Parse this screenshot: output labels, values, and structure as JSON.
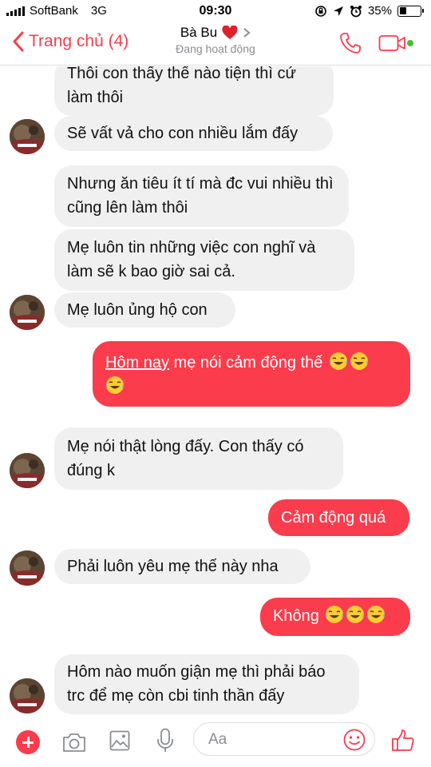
{
  "status_bar": {
    "carrier": "SoftBank",
    "network": "3G",
    "time": "09:30",
    "battery": "35%",
    "battery_level": 0.35
  },
  "header": {
    "back_label": "Trang chủ (4)",
    "contact_name": "Bà Bu",
    "status": "Đang hoạt động"
  },
  "messages": [
    {
      "id": "m1",
      "side": "in",
      "text": "Thôi con thấy thế nào tiện thì cứ làm thôi"
    },
    {
      "id": "m2",
      "side": "in",
      "text": "Sẽ vất vả cho con nhiều lắm đấy"
    },
    {
      "id": "m3",
      "side": "in",
      "text": "Nhưng ăn tiêu ít tí mà đc vui nhiều thì cũng lên làm thôi"
    },
    {
      "id": "m4",
      "side": "in",
      "text": "Mẹ luôn tin những việc con nghĩ và làm sẽ k bao giờ sai cả."
    },
    {
      "id": "m5",
      "side": "in",
      "text": "Mẹ luôn ủng hộ con"
    },
    {
      "id": "m6",
      "side": "out",
      "text_underlined": "Hôm nay",
      "text_rest": " mẹ nói cảm động thế"
    },
    {
      "id": "m7",
      "side": "in",
      "text": "Mẹ nói thật lòng đấy. Con thấy có đúng k"
    },
    {
      "id": "m8",
      "side": "out",
      "text": "Cảm động quá"
    },
    {
      "id": "m9",
      "side": "in",
      "text": "Phải luôn yêu mẹ thế này nha"
    },
    {
      "id": "m10",
      "side": "out",
      "text": "Không"
    },
    {
      "id": "m11",
      "side": "in",
      "text": "Hôm nào muốn giận mẹ thì phải báo trc để mẹ còn cbi tinh thần đấy"
    }
  ],
  "composer": {
    "placeholder": "Aa"
  },
  "colors": {
    "accent": "#fa3c4c",
    "incoming_bubble": "#f1f0f0",
    "online": "#44bd32"
  },
  "icons": [
    "back-chevron-icon",
    "heart-icon",
    "chevron-right-icon",
    "phone-icon",
    "video-icon",
    "plus-icon",
    "camera-icon",
    "gallery-icon",
    "mic-icon",
    "smile-icon",
    "thumbs-up-icon",
    "tears-of-joy-emoji"
  ]
}
